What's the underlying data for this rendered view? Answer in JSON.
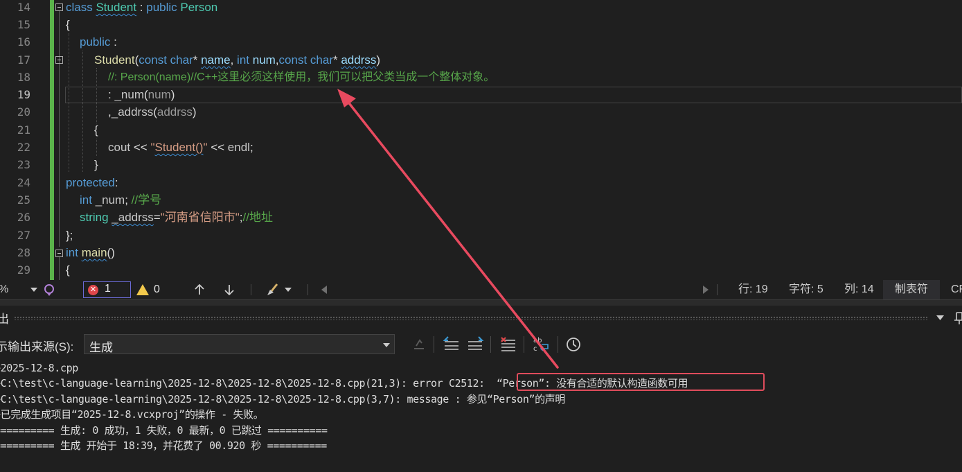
{
  "editor": {
    "line_numbers": [
      "14",
      "15",
      "16",
      "17",
      "18",
      "19",
      "20",
      "21",
      "22",
      "23",
      "24",
      "25",
      "26",
      "27",
      "28",
      "29"
    ],
    "current_line": "19",
    "code": {
      "l14": {
        "kw1": "class ",
        "name": "Student",
        "sep": " : ",
        "kw2": "public ",
        "base": "Person"
      },
      "l15": {
        "t": "{"
      },
      "l16": {
        "kw": "public",
        "p": " :"
      },
      "l17": {
        "fn": "Student",
        "p1": "(",
        "k1": "const ",
        "k2": "char",
        "p2": "* ",
        "a1": "name",
        "p3": ", ",
        "k3": "int ",
        "a2": "num",
        "p4": ",",
        "k4": "const ",
        "k5": "char",
        "p5": "* ",
        "a3": "addrss",
        "p6": ")"
      },
      "l18": {
        "cm": "//: Person(name)//C++这里必须这样使用，我们可以把父类当成一个整体对象。"
      },
      "l19": {
        "p": ": ",
        "v": "_num",
        "p2": "(",
        "a": "num",
        "p3": ")"
      },
      "l20": {
        "p": ",",
        "v": "_addrss",
        "p2": "(",
        "a": "addrss",
        "p3": ")"
      },
      "l21": {
        "t": "{"
      },
      "l22": {
        "v": "cout",
        "p1": " << ",
        "s1": "\"",
        "s2": "Student()",
        "s3": "\"",
        "p2": " << ",
        "v2": "endl",
        "p3": ";"
      },
      "l23": {
        "t": "}"
      },
      "l24": {
        "kw": "protected",
        "p": ":"
      },
      "l25": {
        "kw": "int ",
        "v": "_num",
        "p": "; ",
        "cm": "//学号"
      },
      "l26": {
        "ty": "string ",
        "v": "_addrss",
        "p": "=",
        "s": "\"河南省信阳市\"",
        "p2": ";",
        "cm": "//地址"
      },
      "l27": {
        "t": "};"
      },
      "l28": {
        "kw": "int ",
        "fn": "main",
        "p": "()"
      },
      "l29": {
        "t": "{"
      }
    }
  },
  "status": {
    "zoom": "%",
    "errors": "1",
    "warnings": "0",
    "line": "行: 19",
    "char": "字符: 5",
    "col": "列: 14",
    "tabs": "制表符",
    "eol": "CR"
  },
  "output": {
    "title": "出",
    "source_label": "示输出来源(S):",
    "source_value": "生成",
    "lines": [
      ">2025-12-8.cpp",
      ">C:\\test\\c-language-learning\\2025-12-8\\2025-12-8\\2025-12-8.cpp(21,3): error C2512:  “Person”: 没有合适的默认构造函数可用",
      ">C:\\test\\c-language-learning\\2025-12-8\\2025-12-8\\2025-12-8.cpp(3,7): message : 参见“Person”的声明",
      ">已完成生成项目“2025-12-8.vcxproj”的操作 - 失败。",
      "========== 生成: 0 成功，1 失败，0 最新，0 已跳过 ==========",
      "========== 生成 开始于 18:39，并花费了 00.920 秒 =========="
    ]
  },
  "colors": {
    "background": "#1f1f1f",
    "keyword": "#569cd6",
    "type": "#4ec9b0",
    "function": "#dcdcaa",
    "comment": "#57a64a",
    "string": "#d69d85",
    "change_bar": "#5ab34a",
    "annotation": "#e84a5f"
  },
  "icons": [
    "error-icon",
    "warning-icon",
    "arrow-up-icon",
    "arrow-down-icon",
    "brush-icon",
    "clear-icon",
    "wrap-icon",
    "history-icon"
  ]
}
